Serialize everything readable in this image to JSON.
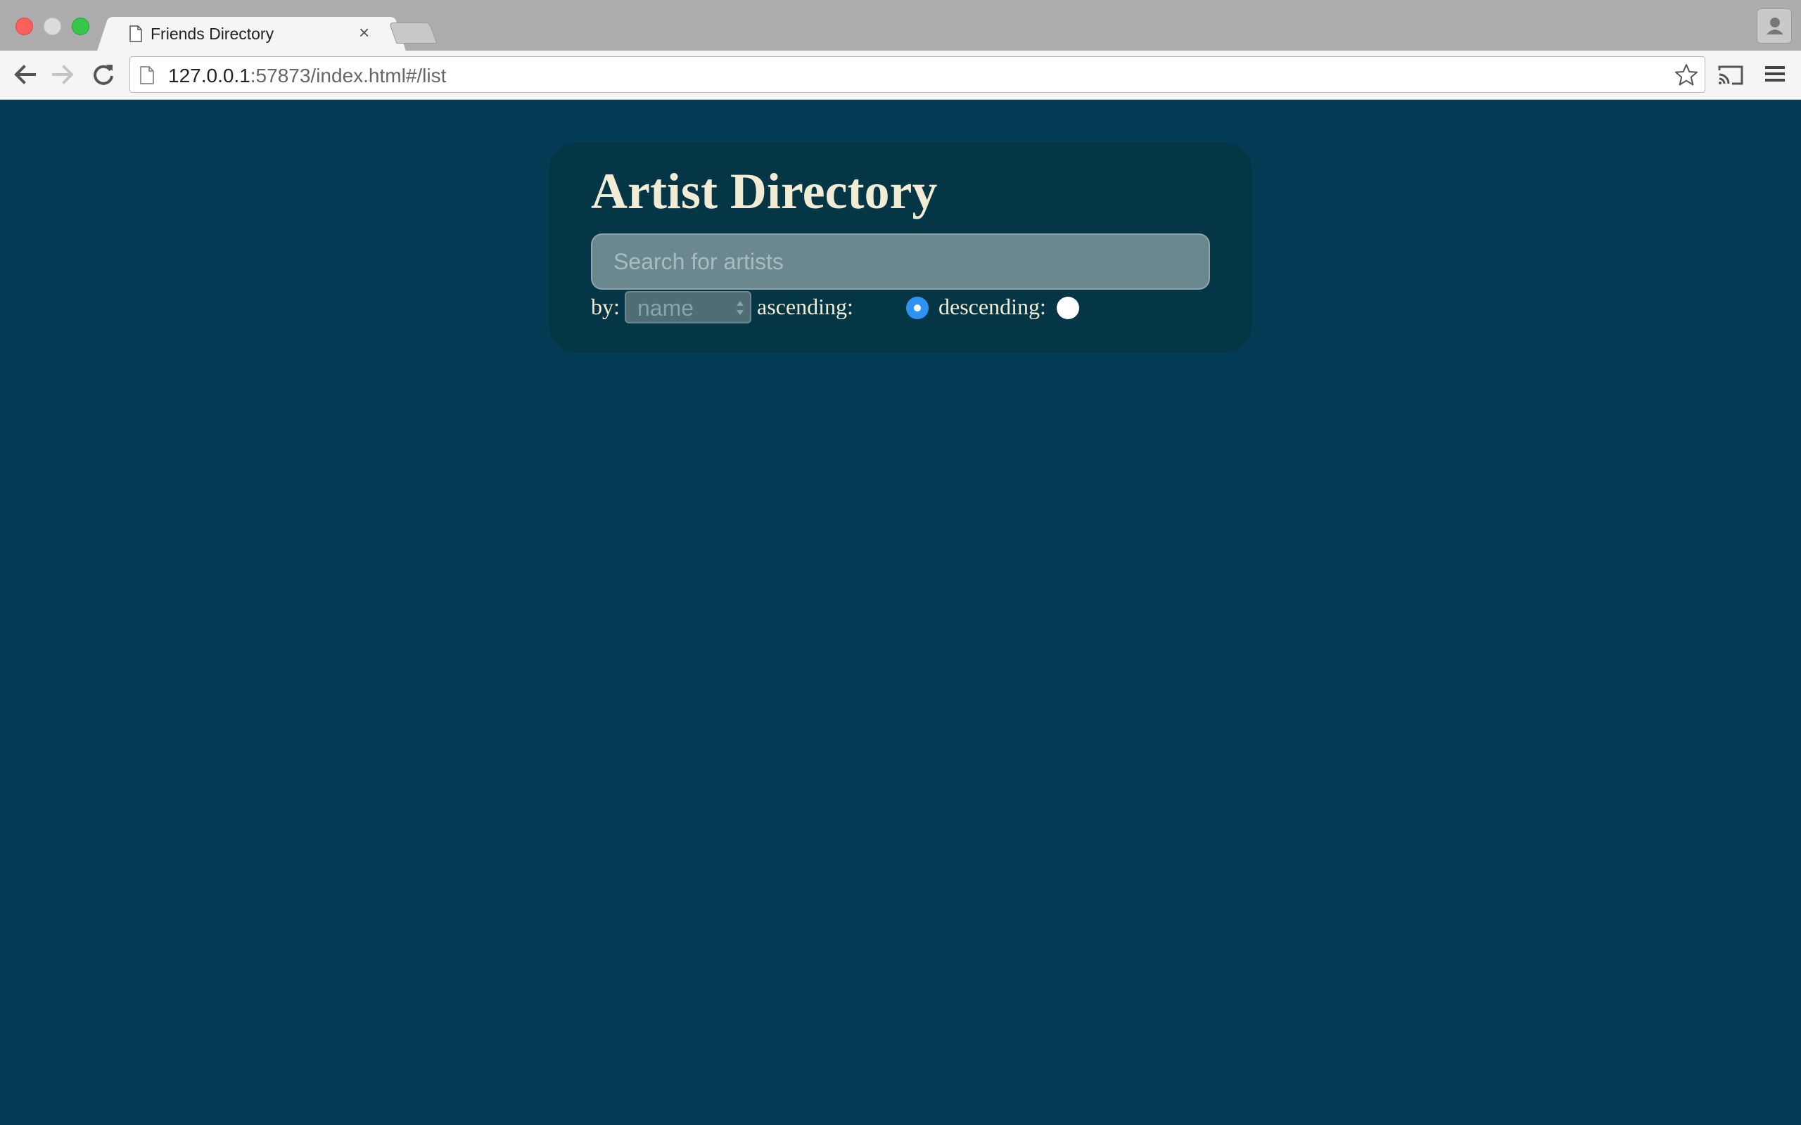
{
  "browser": {
    "tab_title": "Friends Directory",
    "tab_close": "×",
    "url_host": "127.0.0.1",
    "url_rest": ":57873/index.html#/list"
  },
  "page": {
    "title": "Artist Directory",
    "search": {
      "placeholder": "Search for artists",
      "value": ""
    },
    "sort": {
      "by_label": "by:",
      "selected": "name",
      "ascending_label": "ascending:",
      "descending_label": "descending:",
      "ascending_checked": true,
      "descending_checked": false
    }
  },
  "colors": {
    "page_bg": "#033c54",
    "card_bg": "#053646",
    "text": "#f3ecd4",
    "radio_accent": "#2e93f0"
  }
}
